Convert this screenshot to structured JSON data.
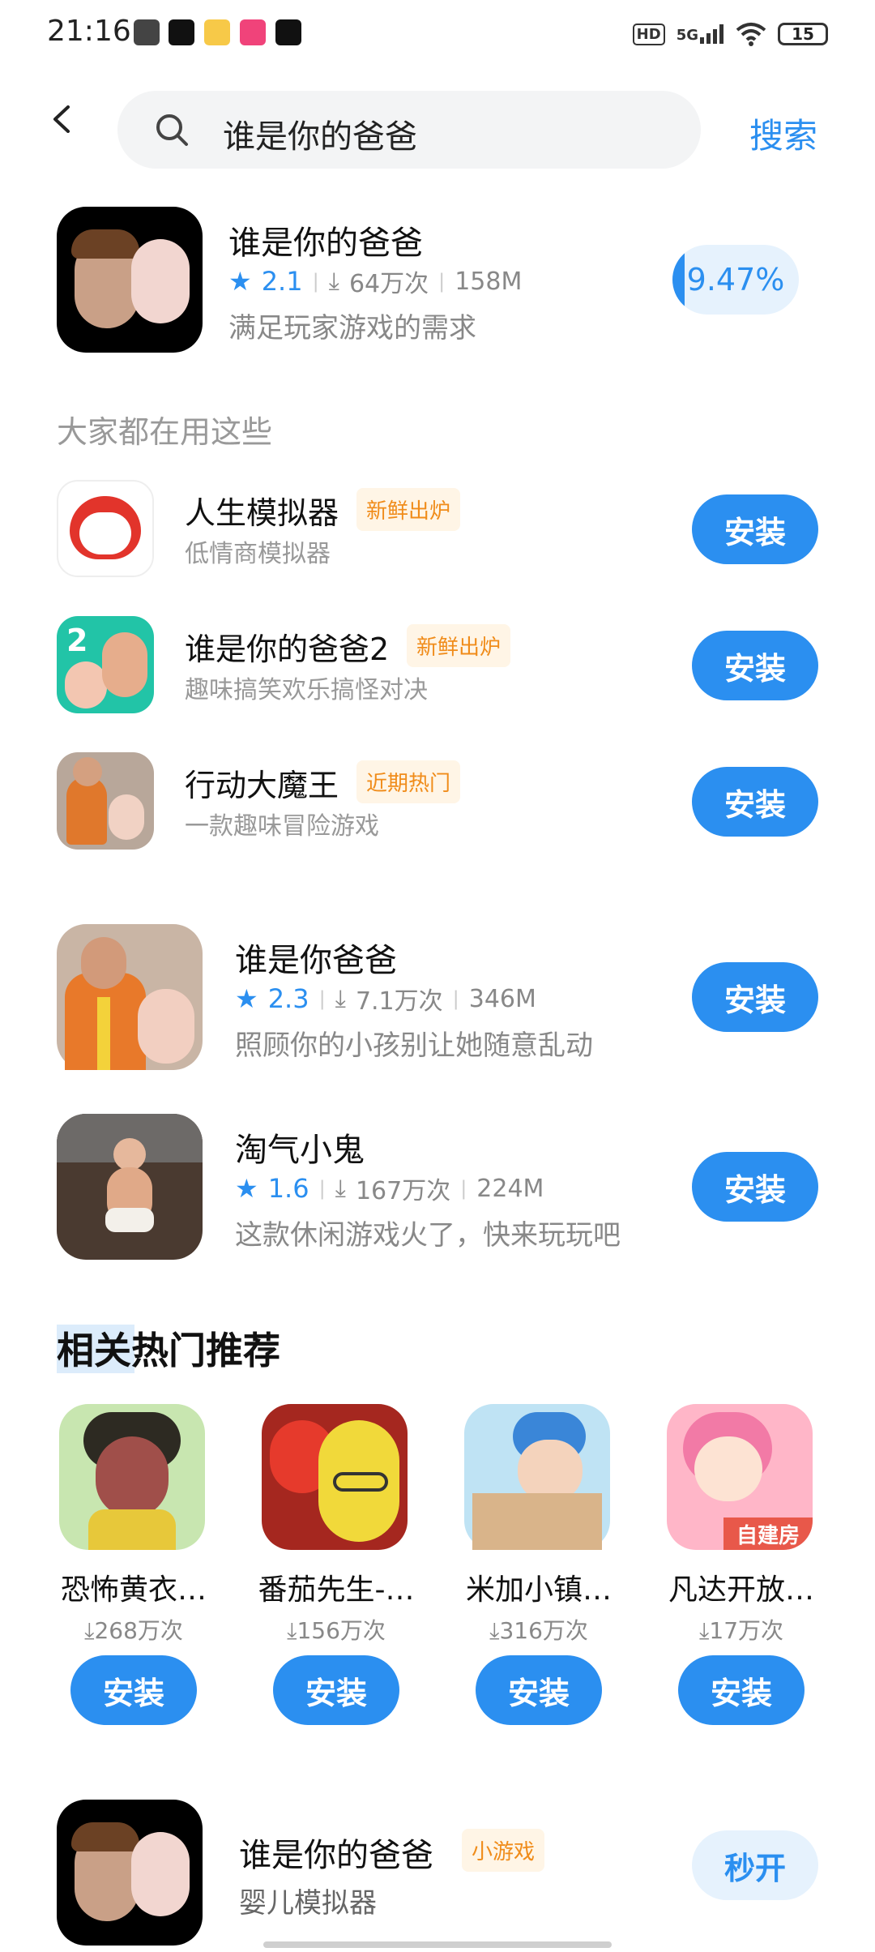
{
  "status": {
    "time": "21:16",
    "hd": "HD",
    "signal": "5G",
    "battery": "15"
  },
  "search": {
    "query": "谁是你的爸爸",
    "button": "搜索"
  },
  "top_result": {
    "name": "谁是你的爸爸",
    "rating": "2.1",
    "downloads": "64万次",
    "size": "158M",
    "desc": "满足玩家游戏的需求",
    "progress": "9.47%",
    "progress_fraction": 0.0947
  },
  "section_used": "大家都在用这些",
  "used_apps": [
    {
      "name": "人生模拟器",
      "tag": "新鲜出炉",
      "desc": "低情商模拟器",
      "button": "安装"
    },
    {
      "name": "谁是你的爸爸2",
      "tag": "新鲜出炉",
      "desc": "趣味搞笑欢乐搞怪对决",
      "button": "安装"
    },
    {
      "name": "行动大魔王",
      "tag": "近期热门",
      "desc": "一款趣味冒险游戏",
      "button": "安装"
    }
  ],
  "results": [
    {
      "name": "谁是你爸爸",
      "rating": "2.3",
      "downloads": "7.1万次",
      "size": "346M",
      "desc": "照顾你的小孩别让她随意乱动",
      "button": "安装"
    },
    {
      "name": "淘气小鬼",
      "rating": "1.6",
      "downloads": "167万次",
      "size": "224M",
      "desc": "这款休闲游戏火了，快来玩玩吧",
      "button": "安装"
    }
  ],
  "section_hot": "相关热门推荐",
  "hot_apps": [
    {
      "name": "恐怖黄衣…",
      "downloads": "268万次",
      "button": "安装"
    },
    {
      "name": "番茄先生-…",
      "downloads": "156万次",
      "button": "安装"
    },
    {
      "name": "米加小镇…",
      "downloads": "316万次",
      "button": "安装"
    },
    {
      "name": "凡达开放…",
      "downloads": "17万次",
      "button": "安装",
      "badge": "自建房"
    }
  ],
  "mini_game": {
    "name": "谁是你的爸爸",
    "tag": "小游戏",
    "desc": "婴儿模拟器",
    "button": "秒开"
  },
  "colors": {
    "accent": "#2b8ff0",
    "tag": "#f08c1a"
  }
}
